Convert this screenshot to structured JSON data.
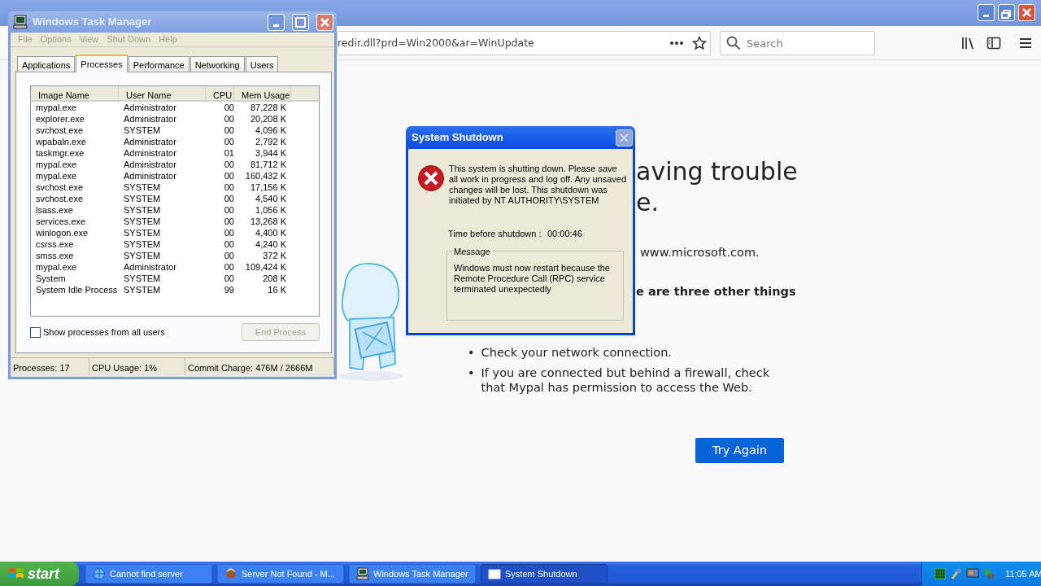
{
  "browser": {
    "address": "redir.dll?prd=Win2000&ar=WinUpdate",
    "search": {
      "placeholder": "Search"
    },
    "page": {
      "heading_lines": [
        "aving trouble",
        "e."
      ],
      "site_text": "www.microsoft.com.",
      "subheading": "e are three other things",
      "bullets": [
        {
          "marker": "•",
          "text": "Check your network connection."
        },
        {
          "marker": "•",
          "text": "If you are connected but behind a firewall, check that Mypal has permission to access the Web."
        }
      ],
      "button": "Try Again"
    }
  },
  "task_manager": {
    "title": "Windows Task Manager",
    "menu": [
      {
        "label": "File",
        "disabled": true
      },
      {
        "label": "Options",
        "disabled": true
      },
      {
        "label": "View",
        "disabled": true
      },
      {
        "label": "Shut Down",
        "disabled": true
      },
      {
        "label": "Help",
        "disabled": true
      }
    ],
    "tabs": [
      {
        "label": "Applications",
        "selected": false
      },
      {
        "label": "Processes",
        "selected": true
      },
      {
        "label": "Performance",
        "selected": false
      },
      {
        "label": "Networking",
        "selected": false
      },
      {
        "label": "Users",
        "selected": false
      }
    ],
    "columns": [
      "Image Name",
      "User Name",
      "CPU",
      "Mem Usage"
    ],
    "rows": [
      [
        "mypal.exe",
        "Administrator",
        "00",
        "87,228 K"
      ],
      [
        "explorer.exe",
        "Administrator",
        "00",
        "20,208 K"
      ],
      [
        "svchost.exe",
        "SYSTEM",
        "00",
        "4,096 K"
      ],
      [
        "wpabaln.exe",
        "Administrator",
        "00",
        "2,792 K"
      ],
      [
        "taskmgr.exe",
        "Administrator",
        "01",
        "3,944 K"
      ],
      [
        "mypal.exe",
        "Administrator",
        "00",
        "81,712 K"
      ],
      [
        "mypal.exe",
        "Administrator",
        "00",
        "160,432 K"
      ],
      [
        "svchost.exe",
        "SYSTEM",
        "00",
        "17,156 K"
      ],
      [
        "svchost.exe",
        "SYSTEM",
        "00",
        "4,540 K"
      ],
      [
        "lsass.exe",
        "SYSTEM",
        "00",
        "1,056 K"
      ],
      [
        "services.exe",
        "SYSTEM",
        "00",
        "13,268 K"
      ],
      [
        "winlogon.exe",
        "SYSTEM",
        "00",
        "4,400 K"
      ],
      [
        "csrss.exe",
        "SYSTEM",
        "00",
        "4,240 K"
      ],
      [
        "smss.exe",
        "SYSTEM",
        "00",
        "372 K"
      ],
      [
        "mypal.exe",
        "Administrator",
        "00",
        "109,424 K"
      ],
      [
        "System",
        "SYSTEM",
        "00",
        "208 K"
      ],
      [
        "System Idle Process",
        "SYSTEM",
        "99",
        "16 K"
      ]
    ],
    "show_all": {
      "label": "Show processes from all users",
      "checked": false
    },
    "end_button": {
      "label": "End Process",
      "disabled": true
    },
    "status_bar": [
      "Processes: 17",
      "CPU Usage: 1%",
      "Commit Charge: 476M / 2666M"
    ]
  },
  "dialog": {
    "title": "System Shutdown",
    "message": "This system is shutting down. Please save all work in progress and log off. Any unsaved changes will be lost. This shutdown was initiated by NT AUTHORITY\\SYSTEM",
    "time_label": "Time before shutdown :",
    "time_value": "00:00:46",
    "group_label": "Message",
    "group_text": "Windows must now restart because the Remote Procedure Call (RPC) service terminated unexpectedly"
  },
  "taskbar": {
    "start": "start",
    "buttons": [
      {
        "label": "Cannot find server",
        "kind": "browser",
        "selected": false
      },
      {
        "label": "Server Not Found - M...",
        "kind": "mypal",
        "selected": false
      },
      {
        "label": "Windows Task Manager",
        "kind": "monitor",
        "selected": false
      },
      {
        "label": "System Shutdown",
        "kind": "window",
        "selected": true
      }
    ],
    "clock": "11:05 AM"
  }
}
